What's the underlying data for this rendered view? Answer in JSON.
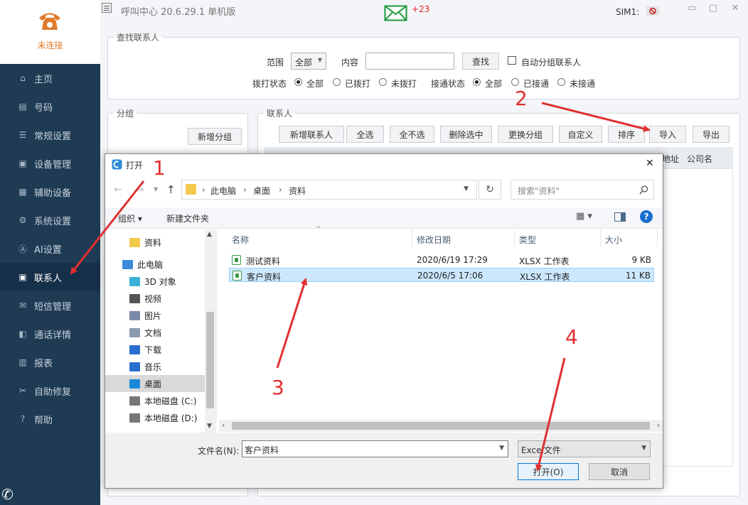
{
  "sidebar": {
    "status": "未连接",
    "items": [
      {
        "label": "主页",
        "icon": "home-icon",
        "glyph": "⌂"
      },
      {
        "label": "号码",
        "icon": "number-icon",
        "glyph": "▤"
      },
      {
        "label": "常规设置",
        "icon": "sliders-icon",
        "glyph": "☰"
      },
      {
        "label": "设备管理",
        "icon": "device-icon",
        "glyph": "▣"
      },
      {
        "label": "辅助设备",
        "icon": "aux-device-icon",
        "glyph": "▦"
      },
      {
        "label": "系统设置",
        "icon": "gear-icon",
        "glyph": "⚙"
      },
      {
        "label": "AI设置",
        "icon": "ai-icon",
        "glyph": "Ⓐ"
      },
      {
        "label": "联系人",
        "icon": "contacts-icon",
        "glyph": "▣"
      },
      {
        "label": "短信管理",
        "icon": "sms-icon",
        "glyph": "✉"
      },
      {
        "label": "通话详情",
        "icon": "call-detail-icon",
        "glyph": "◧"
      },
      {
        "label": "报表",
        "icon": "report-icon",
        "glyph": "▥"
      },
      {
        "label": "自助修复",
        "icon": "repair-icon",
        "glyph": "✂"
      },
      {
        "label": "帮助",
        "icon": "help-icon",
        "glyph": "?"
      }
    ],
    "active_index": 7
  },
  "titlebar": {
    "title": "呼叫中心 20.6.29.1 单机版",
    "mail_count": "+23",
    "sim_label": "SIM1:",
    "minimize": "▭",
    "maximize": "▢",
    "close": "✕"
  },
  "search": {
    "legend": "查找联系人",
    "range_label": "范围",
    "range_value": "全部",
    "content_label": "内容",
    "content_value": "",
    "search_button": "查找",
    "auto_group_label": "自动分组联系人",
    "dial_status_label": "拨打状态",
    "dial_options": [
      "全部",
      "已拨打",
      "未拨打"
    ],
    "connect_status_label": "接通状态",
    "connect_options": [
      "全部",
      "已接通",
      "未接通"
    ]
  },
  "group": {
    "legend": "分组",
    "new_group_button": "新增分组"
  },
  "contacts": {
    "legend": "联系人",
    "toolbar": [
      "新增联系人",
      "全选",
      "全不选",
      "删除选中",
      "更换分组",
      "自定义",
      "排序",
      "导入",
      "导出"
    ],
    "columns_visible": [
      "地址",
      "公司名"
    ]
  },
  "dialog": {
    "title": "打开",
    "close": "✕",
    "breadcrumb": [
      "此电脑",
      "桌面",
      "资料"
    ],
    "search_placeholder": "搜索\"资料\"",
    "organize": "组织 ▾",
    "new_folder": "新建文件夹",
    "tree": [
      {
        "label": "资料",
        "icon": "folder-icon"
      },
      {
        "label": "此电脑",
        "icon": "computer-icon"
      },
      {
        "label": "3D 对象",
        "icon": "3d-objects-icon"
      },
      {
        "label": "视频",
        "icon": "video-icon"
      },
      {
        "label": "图片",
        "icon": "pictures-icon"
      },
      {
        "label": "文档",
        "icon": "documents-icon"
      },
      {
        "label": "下载",
        "icon": "download-icon"
      },
      {
        "label": "音乐",
        "icon": "music-icon"
      },
      {
        "label": "桌面",
        "icon": "desktop-icon"
      },
      {
        "label": "本地磁盘 (C:)",
        "icon": "disk-c-icon"
      },
      {
        "label": "本地磁盘 (D:)",
        "icon": "disk-d-icon"
      }
    ],
    "columns": [
      "名称",
      "修改日期",
      "类型",
      "大小"
    ],
    "files": [
      {
        "name": "测试资料",
        "date": "2020/6/19 17:29",
        "type": "XLSX 工作表",
        "size": "9 KB"
      },
      {
        "name": "客户资料",
        "date": "2020/6/5 17:06",
        "type": "XLSX 工作表",
        "size": "11 KB"
      }
    ],
    "filename_label": "文件名(N):",
    "filename_value": "客户资料",
    "filetype_value": "Excel文件",
    "open_button": "打开(O)",
    "cancel_button": "取消"
  },
  "annotations": [
    "1",
    "2",
    "3",
    "4"
  ],
  "colors": {
    "sidebar": "#1f3b54",
    "accent_orange": "#e07b2c",
    "annotation_red": "#e03030",
    "selected_row": "#cce8ff"
  }
}
